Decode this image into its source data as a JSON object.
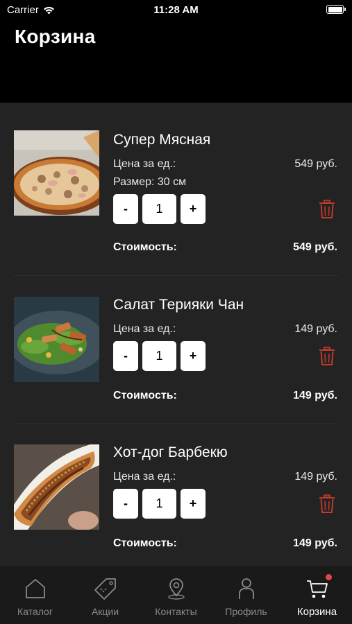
{
  "status_bar": {
    "carrier": "Carrier",
    "time": "11:28 AM"
  },
  "header": {
    "title": "Корзина"
  },
  "cart": {
    "items": [
      {
        "name": "Супер Мясная",
        "unit_price_label": "Цена за ед.:",
        "unit_price": "549 руб.",
        "size": "Размер: 30 см",
        "quantity": "1",
        "total_label": "Стоимость:",
        "total": "549 руб.",
        "minus": "-",
        "plus": "+"
      },
      {
        "name": "Салат Терияки Чан",
        "unit_price_label": "Цена за ед.:",
        "unit_price": "149 руб.",
        "quantity": "1",
        "total_label": "Стоимость:",
        "total": "149 руб.",
        "minus": "-",
        "plus": "+"
      },
      {
        "name": "Хот-дог Барбекю",
        "unit_price_label": "Цена за ед.:",
        "unit_price": "149 руб.",
        "quantity": "1",
        "total_label": "Стоимость:",
        "total": "149 руб.",
        "minus": "-",
        "plus": "+"
      }
    ]
  },
  "tabbar": {
    "tabs": [
      {
        "label": "Каталог",
        "icon": "home-icon"
      },
      {
        "label": "Акции",
        "icon": "tag-icon"
      },
      {
        "label": "Контакты",
        "icon": "map-pin-icon"
      },
      {
        "label": "Профиль",
        "icon": "person-icon"
      },
      {
        "label": "Корзина",
        "icon": "cart-icon",
        "active": true
      }
    ]
  },
  "colors": {
    "background": "#232323",
    "header": "#000000",
    "tabbar": "#1a1a1a",
    "delete": "#c0392b",
    "badge": "#e2454a"
  }
}
